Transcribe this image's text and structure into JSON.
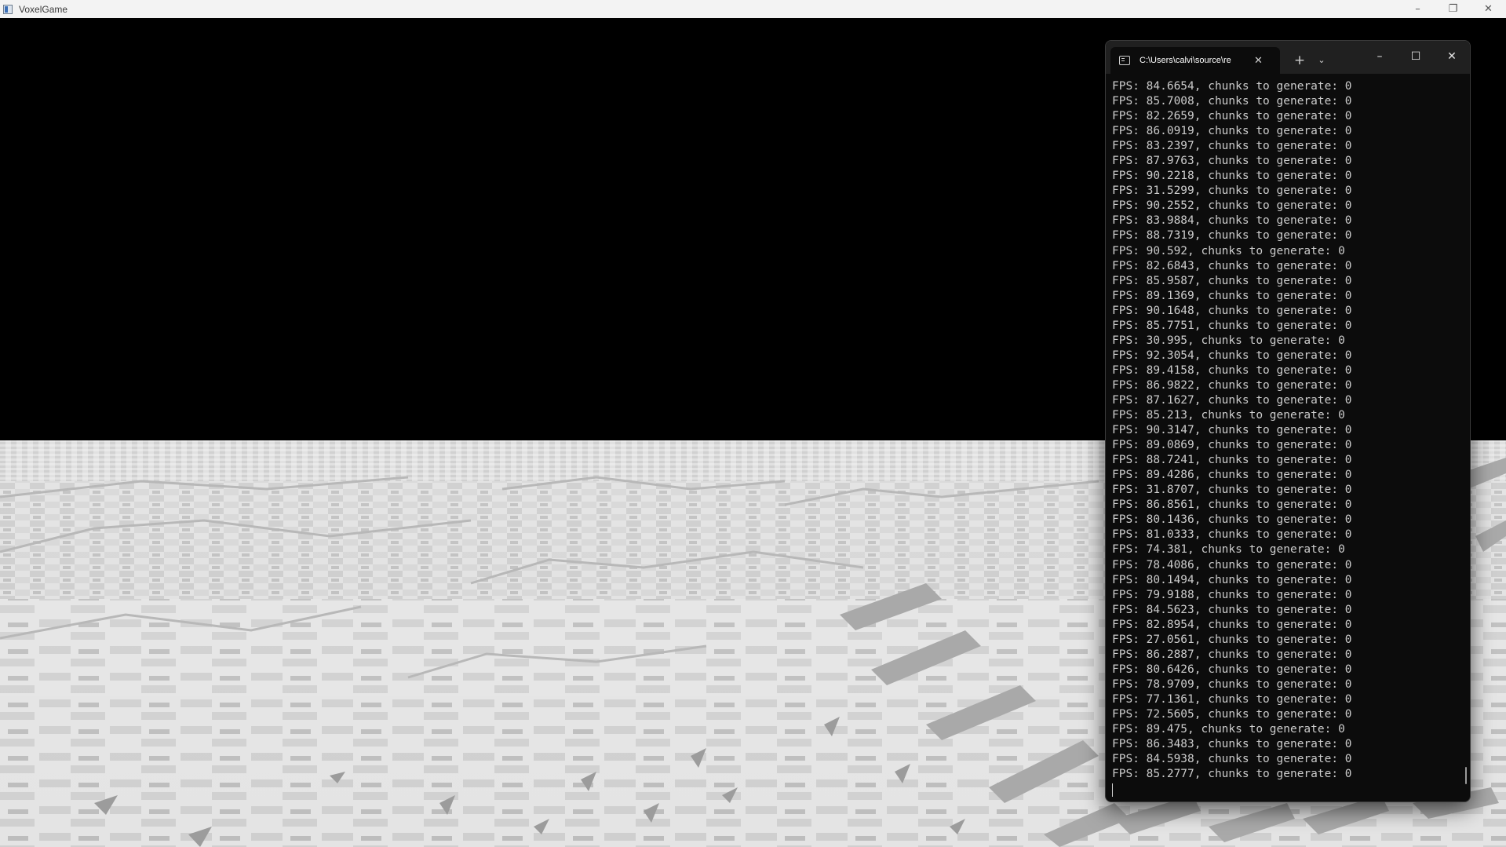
{
  "game_window": {
    "title": "VoxelGame",
    "caption_buttons": {
      "minimize": "–",
      "restore": "❐",
      "close": "✕"
    }
  },
  "terminal": {
    "tab_title": "C:\\Users\\calvi\\source\\re",
    "tab_close": "✕",
    "new_tab": "+",
    "dropdown": "⌄",
    "caption_buttons": {
      "minimize": "–",
      "maximize": "☐",
      "close": "✕"
    },
    "lines": [
      "FPS: 84.6654, chunks to generate: 0",
      "FPS: 85.7008, chunks to generate: 0",
      "FPS: 82.2659, chunks to generate: 0",
      "FPS: 86.0919, chunks to generate: 0",
      "FPS: 83.2397, chunks to generate: 0",
      "FPS: 87.9763, chunks to generate: 0",
      "FPS: 90.2218, chunks to generate: 0",
      "FPS: 31.5299, chunks to generate: 0",
      "FPS: 90.2552, chunks to generate: 0",
      "FPS: 83.9884, chunks to generate: 0",
      "FPS: 88.7319, chunks to generate: 0",
      "FPS: 90.592, chunks to generate: 0",
      "FPS: 82.6843, chunks to generate: 0",
      "FPS: 85.9587, chunks to generate: 0",
      "FPS: 89.1369, chunks to generate: 0",
      "FPS: 90.1648, chunks to generate: 0",
      "FPS: 85.7751, chunks to generate: 0",
      "FPS: 30.995, chunks to generate: 0",
      "FPS: 92.3054, chunks to generate: 0",
      "FPS: 89.4158, chunks to generate: 0",
      "FPS: 86.9822, chunks to generate: 0",
      "FPS: 87.1627, chunks to generate: 0",
      "FPS: 85.213, chunks to generate: 0",
      "FPS: 90.3147, chunks to generate: 0",
      "FPS: 89.0869, chunks to generate: 0",
      "FPS: 88.7241, chunks to generate: 0",
      "FPS: 89.4286, chunks to generate: 0",
      "FPS: 31.8707, chunks to generate: 0",
      "FPS: 86.8561, chunks to generate: 0",
      "FPS: 80.1436, chunks to generate: 0",
      "FPS: 81.0333, chunks to generate: 0",
      "FPS: 74.381, chunks to generate: 0",
      "FPS: 78.4086, chunks to generate: 0",
      "FPS: 80.1494, chunks to generate: 0",
      "FPS: 79.9188, chunks to generate: 0",
      "FPS: 84.5623, chunks to generate: 0",
      "FPS: 82.8954, chunks to generate: 0",
      "FPS: 27.0561, chunks to generate: 0",
      "FPS: 86.2887, chunks to generate: 0",
      "FPS: 80.6426, chunks to generate: 0",
      "FPS: 78.9709, chunks to generate: 0",
      "FPS: 77.1361, chunks to generate: 0",
      "FPS: 72.5605, chunks to generate: 0",
      "FPS: 89.475, chunks to generate: 0",
      "FPS: 86.3483, chunks to generate: 0",
      "FPS: 84.5938, chunks to generate: 0",
      "FPS: 85.2777, chunks to generate: 0"
    ]
  },
  "colors": {
    "sky": "#000000",
    "terrain_light": "#e2e2e2",
    "terrain_shade": "#bdbdbd",
    "terminal_bg": "#0c0c0c",
    "terminal_text": "#cccccc"
  }
}
